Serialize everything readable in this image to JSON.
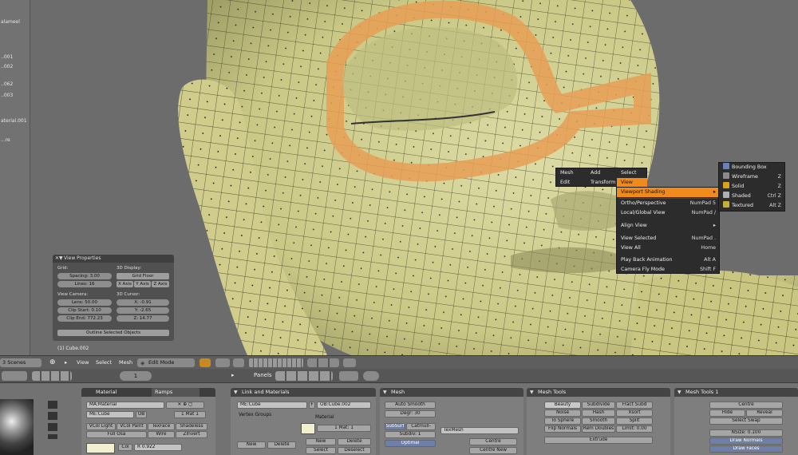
{
  "outliner": {
    "items": [
      "alameel",
      "..001",
      "..002",
      "..062",
      "..003",
      "aterial.001",
      "...re"
    ]
  },
  "view_properties": {
    "title": "View Properties",
    "grid_label": "Grid:",
    "spacing": "Spacing: 3.00",
    "lines": "Lines: 16",
    "display_label": "3D Display:",
    "grid_floor": "Grid Floor",
    "x_axis": "X Axis",
    "y_axis": "Y Axis",
    "z_axis": "Z Axis",
    "camera_label": "View Camera:",
    "lens": "Lens: 50.00",
    "clip_start": "Clip Start: 0.10",
    "clip_end": "Clip End: 772.23",
    "cursor_label": "3D Cursor:",
    "cx": "X: -0.91",
    "cy": "Y: -2.65",
    "cz": "Z: 14.77",
    "outline_btn": "Outline Selected Objects"
  },
  "viewport_object": "(1) Cube.002",
  "view_header": {
    "scenes": "3 Scenes",
    "view": "View",
    "select": "Select",
    "mesh": "Mesh",
    "mode": "Edit Mode"
  },
  "buttons_header": {
    "panels": "Panels",
    "frame": "1"
  },
  "material_panel": {
    "tabs": [
      "Material",
      "Ramps"
    ],
    "ma_name": "MA:Material",
    "me_name": "ME:Cube",
    "ob_btn": "OB",
    "mat_count": "1 Mat 1",
    "vcol_light": "VCol Light",
    "vcol_paint": "VCol Paint",
    "texface": "TexFace",
    "shadeless": "Shadeless",
    "full_osa": "Full Osa",
    "wire": "Wire",
    "ztransp": "ZInvert",
    "col": "Col",
    "r": "R 0.922"
  },
  "link_panel": {
    "title": "Link and Materials",
    "me": "ME:Cube",
    "f": "F",
    "ob": "OB:Cube.002",
    "vertex_groups": "Vertex Groups",
    "material": "Material",
    "mat": "1 Mat: 1",
    "new": "New",
    "delete": "Delete",
    "new2": "New",
    "delete2": "Delete",
    "select": "Select",
    "deselect": "Deselect"
  },
  "mesh_panel": {
    "title": "Mesh",
    "auto_smooth": "Auto Smooth",
    "degr": "Degr: 30",
    "subsurf": "SubSurf",
    "catmull": "Catmull-",
    "subdiv": "Subdiv: 1",
    "texmesh": "TexMesh",
    "centre": "Centre",
    "optimal": "Optimal",
    "centre_new": "Centre New"
  },
  "mesh_tools": {
    "title": "Mesh Tools",
    "beauty": "Beauty",
    "subdivide": "Subdivide",
    "fract_subd": "Fract Subd",
    "noise": "Noise",
    "hash": "Hash",
    "xsort": "Xsort",
    "to_sphere": "To Sphere",
    "smooth": "Smooth",
    "split": "Split",
    "flip_normals": "Flip Normals",
    "rem_doubles": "Rem Doubles",
    "limit": "Limit: 0.00",
    "extrude": "Extrude"
  },
  "mesh_tools1": {
    "title": "Mesh Tools 1",
    "centre": "Centre",
    "hide": "Hide",
    "reveal": "Reveal",
    "select_swap": "Select Swap",
    "nsize": "NSize: 0.100",
    "draw_normals": "Draw Normals",
    "draw_faces": "Draw Faces"
  },
  "menu_bar": {
    "mesh": "Mesh",
    "add": "Add",
    "select": "Select",
    "edit": "Edit",
    "transform": "Transform",
    "view": "View"
  },
  "view_menu": [
    {
      "label": "Viewport Shading",
      "shortcut": "",
      "highlight": true,
      "arrow": true
    },
    {
      "label": "Ortho/Perspective",
      "shortcut": "NumPad 5"
    },
    {
      "label": "Local/Global View",
      "shortcut": "NumPad /"
    },
    {
      "label": "Align View",
      "shortcut": ""
    },
    {
      "label": "View Selected",
      "shortcut": "NumPad ."
    },
    {
      "label": "View All",
      "shortcut": "Home"
    },
    {
      "label": "Play Back Animation",
      "shortcut": "Alt A"
    },
    {
      "label": "Camera Fly Mode",
      "shortcut": "Shift F"
    }
  ],
  "shading_menu": [
    {
      "label": "Bounding Box",
      "shortcut": "",
      "color": "#6a7fc0"
    },
    {
      "label": "Wireframe",
      "shortcut": "Z",
      "color": "#8a8a8a"
    },
    {
      "label": "Solid",
      "shortcut": "Z",
      "color": "#d8a020"
    },
    {
      "label": "Shaded",
      "shortcut": "Ctrl Z",
      "color": "#b0b0b0"
    },
    {
      "label": "Textured",
      "shortcut": "Alt Z",
      "color": "#c8b030"
    }
  ],
  "colors": {
    "accent": "#f08a1a",
    "mesh_face": "#d6d49a",
    "edge_loop": "#e8a060"
  }
}
